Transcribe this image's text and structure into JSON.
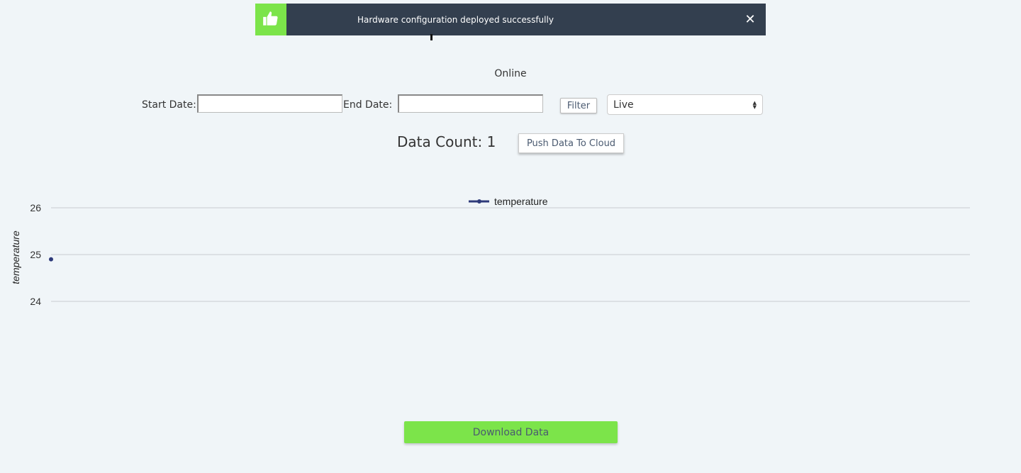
{
  "toast": {
    "message": "Hardware configuration deployed successfully",
    "close_glyph": "✕",
    "icon": "thumbs-up-icon",
    "accent": "#7ce44a",
    "background": "#333f4f"
  },
  "status": "Online",
  "filters": {
    "start_label": "Start Date:",
    "start_value": "",
    "end_label": "End Date:",
    "end_value": "",
    "filter_button": "Filter",
    "mode_select": "Live"
  },
  "data_count_label": "Data Count: 1",
  "push_button": "Push Data To Cloud",
  "download_button": "Download Data",
  "chart_data": {
    "type": "line",
    "title": "",
    "ylabel": "temperature",
    "xlabel": "",
    "ylim": [
      24,
      26
    ],
    "yticks": [
      24,
      25,
      26
    ],
    "legend": "top-center",
    "grid": true,
    "series": [
      {
        "name": "temperature",
        "color": "#2e3a7a",
        "x": [
          0
        ],
        "y": [
          24.9
        ]
      }
    ]
  }
}
